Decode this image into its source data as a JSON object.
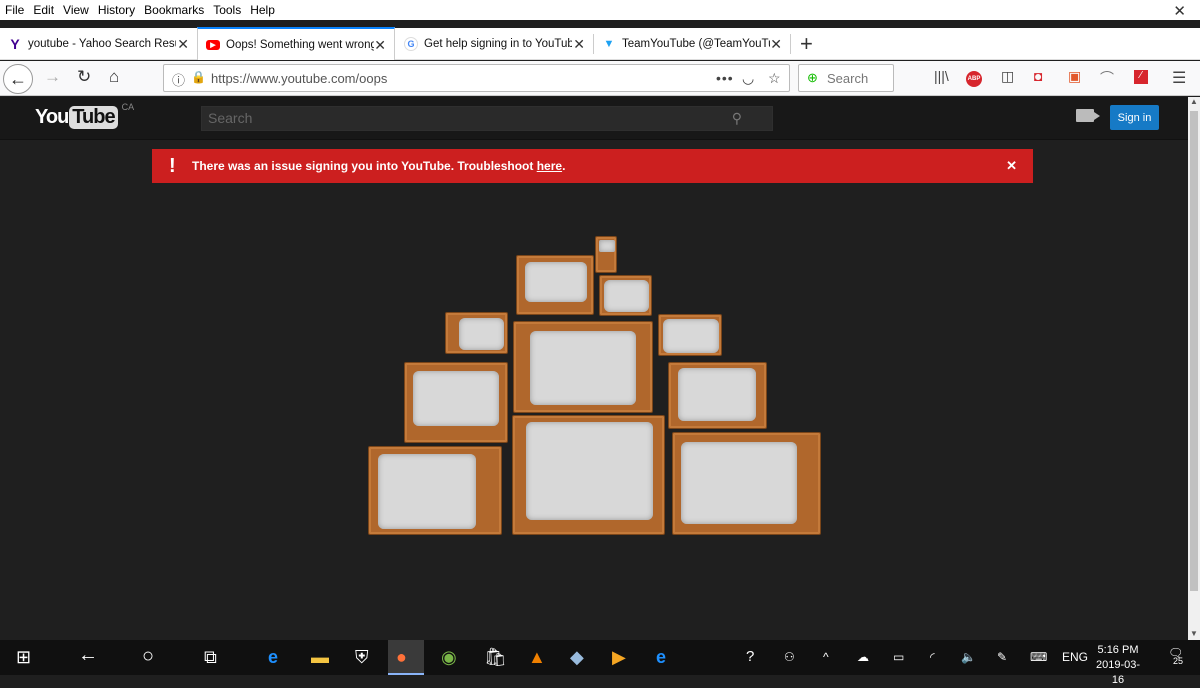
{
  "menu": [
    "File",
    "Edit",
    "View",
    "History",
    "Bookmarks",
    "Tools",
    "Help"
  ],
  "tabs": [
    {
      "title": "youtube - Yahoo Search Resul",
      "favicon": "Y",
      "color": "#400090"
    },
    {
      "title": "Oops! Something went wrong",
      "favicon": "▶",
      "color": "#ff0000"
    },
    {
      "title": "Get help signing in to YouTub",
      "favicon": "G",
      "color": "#4285f4"
    },
    {
      "title": "TeamYouTube (@TeamYouTu",
      "favicon": "🐦",
      "color": "#1da1f2"
    }
  ],
  "address": {
    "url": "https://www.youtube.com/oops"
  },
  "browser_search": {
    "placeholder": "Search"
  },
  "youtube": {
    "logo_you": "You",
    "logo_tube": "Tube",
    "region": "CA",
    "search_placeholder": "Search",
    "signin": "Sign in",
    "alert": {
      "text": "There was an issue signing you into YouTube. Troubleshoot ",
      "link": "here",
      "tail": "."
    }
  },
  "clock": {
    "time": "5:16 PM",
    "date": "2019-03-16"
  },
  "tray": {
    "lang": "ENG",
    "notifications": "25"
  }
}
